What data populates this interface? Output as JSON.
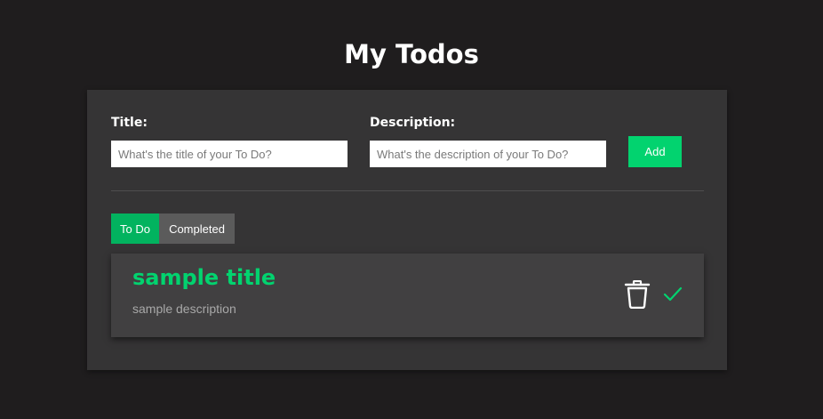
{
  "page": {
    "title": "My Todos"
  },
  "form": {
    "title_label": "Title:",
    "title_placeholder": "What's the title of your To Do?",
    "title_value": "",
    "description_label": "Description:",
    "description_placeholder": "What's the description of your To Do?",
    "description_value": "",
    "add_label": "Add"
  },
  "tabs": [
    {
      "label": "To Do",
      "active": true
    },
    {
      "label": "Completed",
      "active": false
    }
  ],
  "todos": [
    {
      "title": "sample title",
      "description": "sample description",
      "actions": [
        "trash-icon",
        "check-icon"
      ]
    }
  ],
  "colors": {
    "background": "#1f1d1e",
    "panel": "#353435",
    "card": "#414041",
    "accent": "#02d36f",
    "tab_active": "#02b35f",
    "tab_inactive": "#5b5b5b"
  }
}
